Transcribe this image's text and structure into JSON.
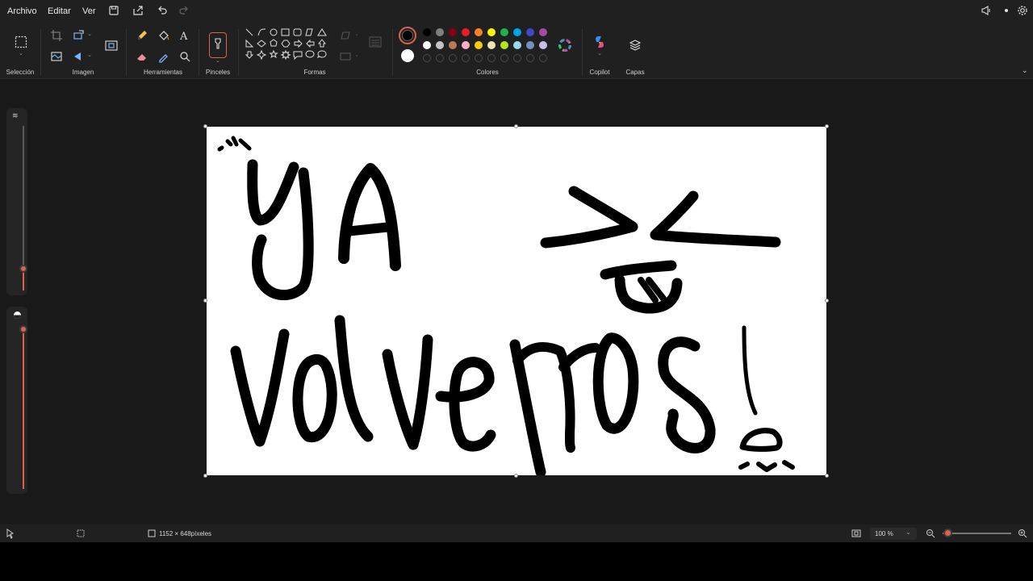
{
  "menubar": {
    "archivo": "Archivo",
    "editar": "Editar",
    "ver": "Ver"
  },
  "ribbon": {
    "groups": {
      "seleccion": "Selección",
      "imagen": "Imagen",
      "herramientas": "Herramientas",
      "pinceles": "Pinceles",
      "formas": "Formas",
      "colores": "Colores",
      "copilot": "Copilot",
      "capas": "Capas"
    },
    "colors": {
      "primary": "#000000",
      "secondary": "#ffffff",
      "palette_row1": [
        "#000000",
        "#7f7f7f",
        "#880015",
        "#ed1c24",
        "#ff7f27",
        "#fff200",
        "#22b14c",
        "#00a2e8",
        "#3f48cc",
        "#a349a4"
      ],
      "palette_row2": [
        "#ffffff",
        "#c3c3c3",
        "#b97a57",
        "#ffaec9",
        "#ffc90e",
        "#efe4b0",
        "#b5e61d",
        "#99d9ea",
        "#7092be",
        "#c8bfe7"
      ]
    }
  },
  "canvas": {
    "background": "#ffffff",
    "stroke_color": "#000000"
  },
  "status": {
    "canvas_size": "1152 × 648píxeles",
    "zoom": "100 %",
    "zoom_level": 0.08
  },
  "accent": "#d9634f"
}
